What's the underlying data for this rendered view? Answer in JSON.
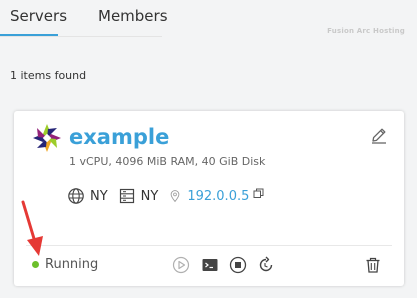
{
  "tabs": [
    {
      "label": "Servers",
      "active": true
    },
    {
      "label": "Members",
      "active": false
    }
  ],
  "watermark": "Fusion Arc Hosting",
  "items_found": "1 items found",
  "server": {
    "name": "example",
    "specs": "1 vCPU, 4096 MiB RAM, 40 GiB Disk",
    "region": "NY",
    "datacenter": "NY",
    "ip": "192.0.0.5",
    "status": "Running",
    "status_color": "#6cbf2b"
  },
  "colors": {
    "accent": "#3aa0d8",
    "annotation_arrow": "#e53935",
    "icon_gray": "#9a9a9a"
  },
  "icons": {
    "os": "centos-logo-icon",
    "edit": "pencil-icon",
    "region": "globe-icon",
    "datacenter": "server-rack-icon",
    "location": "map-pin-icon",
    "copy": "copy-icon",
    "start": "play-icon",
    "console": "terminal-icon",
    "stop": "stop-icon",
    "restart": "restart-icon",
    "delete": "trash-icon"
  }
}
